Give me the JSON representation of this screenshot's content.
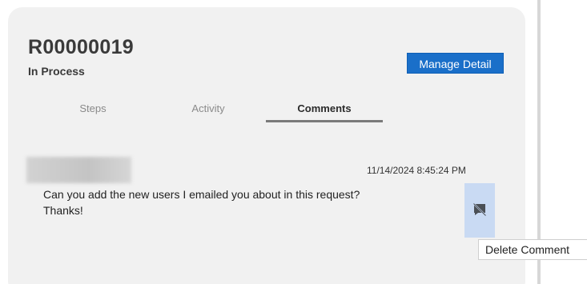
{
  "record": {
    "id": "R00000019",
    "status": "In Process"
  },
  "actions": {
    "manage_detail_label": "Manage Detail"
  },
  "tabs": [
    {
      "label": "Steps",
      "active": false
    },
    {
      "label": "Activity",
      "active": false
    },
    {
      "label": "Comments",
      "active": true
    }
  ],
  "comment": {
    "timestamp": "11/14/2024 8:45:24 PM",
    "text_line1": "Can you add the new users I emailed you about in this request?",
    "text_line2": "Thanks!",
    "delete_icon": "comment-slash-icon"
  },
  "tooltip": {
    "text": "Delete Comment"
  },
  "colors": {
    "accent": "#1a6fc9",
    "card_bg": "#f1f1f1",
    "delete_highlight": "#c9daf3"
  }
}
